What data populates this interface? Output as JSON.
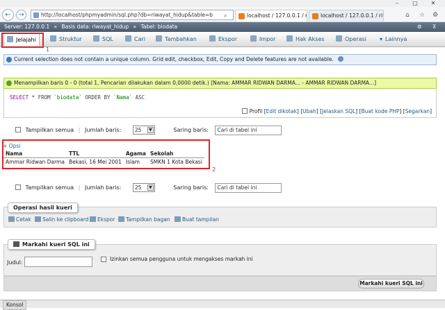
{
  "browser": {
    "address": "http://localhost/phpmyadmin/sql.php?db=riwayat_hidup&table=b",
    "tabs": [
      {
        "label": "localhost / 127.0.0.1 / riwayat..."
      },
      {
        "label": "localhost / 127.0.0.1 / riwa..."
      }
    ]
  },
  "breadcrumb": {
    "server": "Server: 127.0.0.1",
    "database": "Basis data: riwayat_hidup",
    "table": "Tabel: biodata"
  },
  "menu": {
    "tabs": [
      {
        "label": "Jelajahi"
      },
      {
        "label": "Struktur"
      },
      {
        "label": "SQL"
      },
      {
        "label": "Cari"
      },
      {
        "label": "Tambahkan"
      },
      {
        "label": "Ekspor"
      },
      {
        "label": "Impor"
      },
      {
        "label": "Hak Akses"
      },
      {
        "label": "Operasi"
      },
      {
        "label": "Lainnya"
      }
    ]
  },
  "annotations": {
    "label1": "1",
    "label2": "2"
  },
  "notices": {
    "info": "Current selection does not contain a unique column. Grid edit, checkbox, Edit, Copy and Delete features are not available.",
    "success": "Menampilkan baris 0 - 0 (total 1, Pencarian dilakukan dalam 0,0000 detik.) [Nama: AMMAR RIDWAN DARMA... - AMMAR RIDWAN DARMA...]"
  },
  "sql": {
    "select": "SELECT",
    "star_from": " * FROM ",
    "table": "`biodata`",
    "order": " ORDER BY ",
    "column": "`Nama`",
    "asc": " ASC",
    "profil": "Profil",
    "links": [
      "Edit dikotak",
      "Ubah",
      "Jelaskan SQL",
      "Buat kode PHP",
      "Segarkan"
    ]
  },
  "controls": {
    "show_all": "Tampilkan semua",
    "rows_label": "Jumlah baris:",
    "rows_value": "25",
    "filter_label": "Saring baris:",
    "filter_placeholder": "Cari di tabel ini"
  },
  "result": {
    "options": "+ Opsi",
    "columns": [
      "Nama",
      "TTL",
      "Agama",
      "Sekolah"
    ],
    "rows": [
      [
        "Ammar Ridwan Darma",
        "Bekasi, 16 Mei 2001",
        "Islam",
        "SMKN 1 Kota Bekasi"
      ]
    ]
  },
  "query_ops": {
    "title": "Operasi hasil kueri",
    "actions": [
      "Cetak",
      "Salin ke clipboard",
      "Ekspor",
      "Tampilkan bagan",
      "Buat tampilan"
    ]
  },
  "bookmark": {
    "title": "Markahi kueri SQL ini",
    "label_field": "Judul:",
    "shared_label": "Izinkan semua pengguna untuk mengakses markah ini",
    "submit": "Markahi kueri SQL ini"
  },
  "console": {
    "label": "Konsol"
  }
}
